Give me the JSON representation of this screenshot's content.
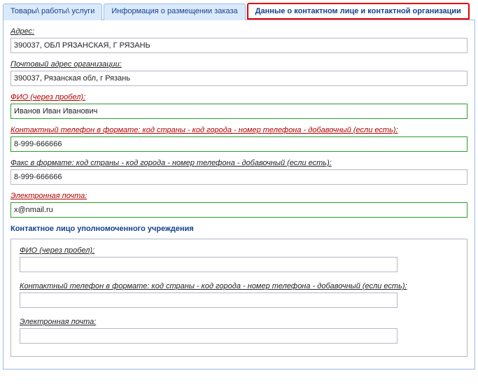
{
  "tabs": [
    {
      "label": "Товары\\ работы\\ услуги"
    },
    {
      "label": "Информация о размещении заказа"
    },
    {
      "label": "Данные о контактном лице и контактной организации"
    }
  ],
  "form": {
    "address": {
      "label": "Адрес:",
      "value": "390037, ОБЛ РЯЗАНСКАЯ, Г РЯЗАНЬ"
    },
    "postal": {
      "label": "Почтовый адрес организации:",
      "value": "390037, Рязанская обл, г Рязань"
    },
    "fio": {
      "label": "ФИО (через пробел):",
      "value": "Иванов Иван Иванович"
    },
    "phone": {
      "label": "Контактный телефон в формате: код страны - код города - номер телефона - добавочный (если есть):",
      "value": "8-999-666666"
    },
    "fax": {
      "label": "Факс в формате: код страны - код города - номер телефона - добавочный (если есть):",
      "value": "8-999-666666"
    },
    "email": {
      "label": "Электронная почта:",
      "value": "x@nmail.ru"
    }
  },
  "fieldset": {
    "title": "Контактное лицо уполномоченного учреждения",
    "fio": {
      "label": "ФИО (через пробел):",
      "value": ""
    },
    "phone": {
      "label": "Контактный телефон в формате: код страны - код города - номер телефона - добавочный (если есть):",
      "value": ""
    },
    "email": {
      "label": "Электронная почта:",
      "value": ""
    }
  }
}
